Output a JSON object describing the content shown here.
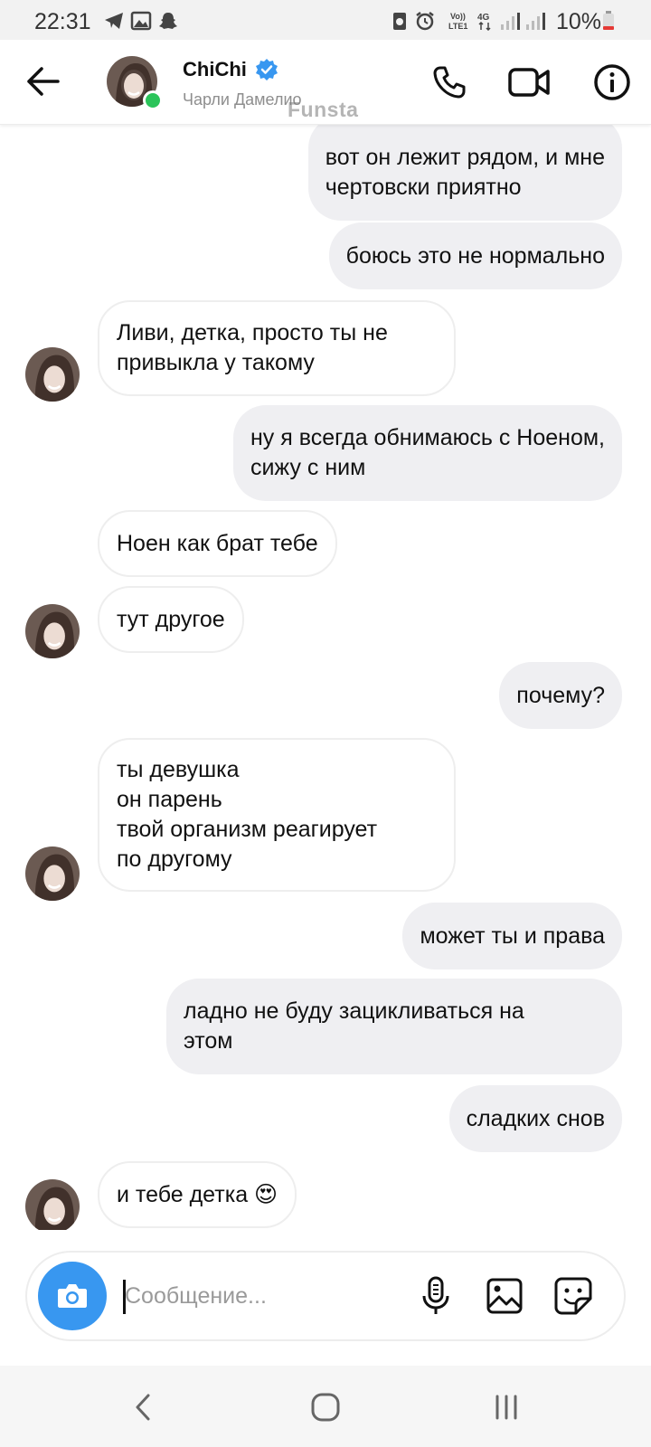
{
  "status_bar": {
    "time": "22:31",
    "battery_percent": "10%",
    "icons": [
      "telegram-icon",
      "gallery-icon",
      "snapchat-icon",
      "data-saver-icon",
      "alarm-icon",
      "volte-icon",
      "4g-icon",
      "signal-icon",
      "battery-icon"
    ],
    "volte_label": "Vo)) LTE1",
    "network_label": "4G"
  },
  "header": {
    "name": "ChiChi",
    "subtitle": "Чарли Дамелио",
    "watermark": "Funsta",
    "verified_color": "#3897f0",
    "online_color": "#2bc45a"
  },
  "messages": [
    {
      "dir": "out",
      "text": "вот он лежит рядом, и мне\nчертовски приятно"
    },
    {
      "dir": "out",
      "text": "боюсь это не нормально"
    },
    {
      "dir": "in",
      "text": "Ливи, детка, просто ты не\nпривыкла у такому",
      "avatar": true
    },
    {
      "dir": "out",
      "text": "ну я всегда обнимаюсь с Ноеном,\nсижу с ним"
    },
    {
      "dir": "in",
      "text": "Ноен как брат тебе",
      "avatar": false
    },
    {
      "dir": "in",
      "text": "тут другое",
      "avatar": true
    },
    {
      "dir": "out",
      "text": "почему?"
    },
    {
      "dir": "in",
      "text": "ты девушка\nон парень\nтвой организм реагирует\nпо другому",
      "avatar": true
    },
    {
      "dir": "out",
      "text": "может ты и права"
    },
    {
      "dir": "out",
      "text": "ладно не буду зацикливаться на\nэтом"
    },
    {
      "dir": "out",
      "text": "сладких снов"
    },
    {
      "dir": "in",
      "text": "и тебе детка 😍",
      "avatar": true
    }
  ],
  "composer": {
    "placeholder": "Сообщение...",
    "value": "",
    "camera_color": "#3897f0",
    "icons": [
      "camera-icon",
      "microphone-icon",
      "image-icon",
      "sticker-icon"
    ]
  },
  "nav": {
    "icons": [
      "back-nav-icon",
      "home-icon",
      "recents-icon"
    ]
  }
}
